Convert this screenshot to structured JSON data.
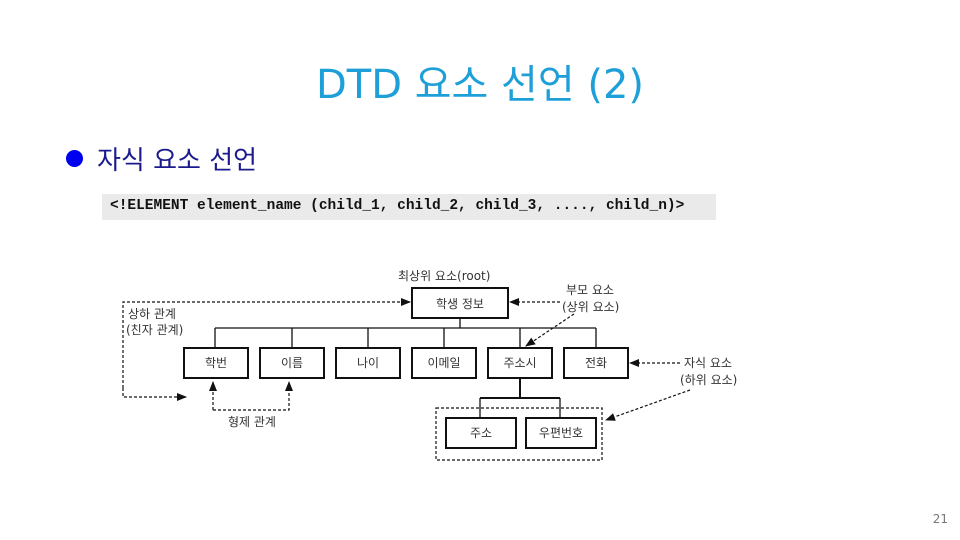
{
  "slide": {
    "title": "DTD 요소 선언 (2)",
    "bullet": "자식 요소 선언",
    "code": "<!ELEMENT element_name (child_1, child_2, child_3, ...., child_n)>",
    "page_number": "21"
  },
  "diagram": {
    "root_caption": "최상위 요소(root)",
    "root": "학생 정보",
    "children": [
      "학번",
      "이름",
      "나이",
      "이메일",
      "주소시",
      "전화"
    ],
    "grandchildren": [
      "주소",
      "우편번호"
    ],
    "labels": {
      "parent_line1": "부모 요소",
      "parent_line2": "(상위 요소)",
      "child_line1": "자식 요소",
      "child_line2": "(하위 요소)",
      "hierarchy_line1": "상하 관계",
      "hierarchy_line2": "(친자 관계)",
      "sibling": "형제 관계"
    }
  }
}
